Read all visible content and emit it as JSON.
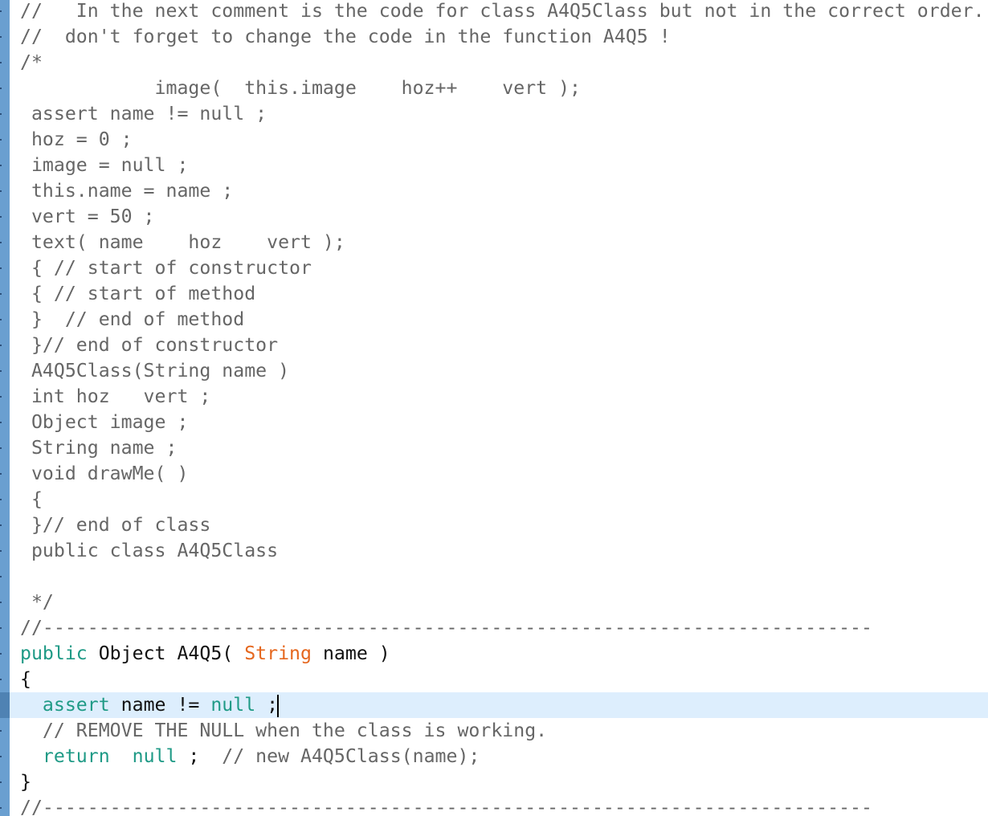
{
  "editor": {
    "gutter_color": "#6a9fd0",
    "current_line_highlight": "#ddeefd",
    "current_line_index": 27,
    "colors": {
      "comment": "#666666",
      "keyword": "#1f9a86",
      "type": "#e5671e",
      "plain": "#111111"
    },
    "lines": [
      [
        {
          "t": "//   In the next comment is the code for class A4Q5Class but not in the correct order.",
          "c": "cm"
        }
      ],
      [
        {
          "t": "//  don't forget to change the code in the function A4Q5 !",
          "c": "cm"
        }
      ],
      [
        {
          "t": "/*",
          "c": "cm"
        }
      ],
      [
        {
          "t": "            image(  this.image    hoz++    vert );",
          "c": "cm"
        }
      ],
      [
        {
          "t": " assert name != null ;",
          "c": "cm"
        }
      ],
      [
        {
          "t": " hoz = 0 ;",
          "c": "cm"
        }
      ],
      [
        {
          "t": " image = null ;",
          "c": "cm"
        }
      ],
      [
        {
          "t": " this.name = name ;",
          "c": "cm"
        }
      ],
      [
        {
          "t": " vert = 50 ;",
          "c": "cm"
        }
      ],
      [
        {
          "t": " text( name    hoz    vert );",
          "c": "cm"
        }
      ],
      [
        {
          "t": " { // start of constructor",
          "c": "cm"
        }
      ],
      [
        {
          "t": " { // start of method",
          "c": "cm"
        }
      ],
      [
        {
          "t": " }  // end of method",
          "c": "cm"
        }
      ],
      [
        {
          "t": " }// end of constructor",
          "c": "cm"
        }
      ],
      [
        {
          "t": " A4Q5Class(String name )",
          "c": "cm"
        }
      ],
      [
        {
          "t": " int hoz   vert ;",
          "c": "cm"
        }
      ],
      [
        {
          "t": " Object image ;",
          "c": "cm"
        }
      ],
      [
        {
          "t": " String name ;",
          "c": "cm"
        }
      ],
      [
        {
          "t": " void drawMe( )",
          "c": "cm"
        }
      ],
      [
        {
          "t": " {",
          "c": "cm"
        }
      ],
      [
        {
          "t": " }// end of class",
          "c": "cm"
        }
      ],
      [
        {
          "t": " public class A4Q5Class",
          "c": "cm"
        }
      ],
      [],
      [
        {
          "t": " */",
          "c": "cm"
        }
      ],
      [
        {
          "t": "//--------------------------------------------------------------------------",
          "c": "cm"
        }
      ],
      [
        {
          "t": "public",
          "c": "kw"
        },
        {
          "t": " Object A4Q5( ",
          "c": "pl"
        },
        {
          "t": "String",
          "c": "ty"
        },
        {
          "t": " name )",
          "c": "pl"
        }
      ],
      [
        {
          "t": "{",
          "c": "pl"
        }
      ],
      [
        {
          "t": "  ",
          "c": "pl"
        },
        {
          "t": "assert",
          "c": "kw"
        },
        {
          "t": " name != ",
          "c": "pl"
        },
        {
          "t": "null",
          "c": "kw"
        },
        {
          "t": " ;",
          "c": "pl"
        }
      ],
      [
        {
          "t": "  // REMOVE THE NULL when the class is working.",
          "c": "cm"
        }
      ],
      [
        {
          "t": "  ",
          "c": "pl"
        },
        {
          "t": "return",
          "c": "kw"
        },
        {
          "t": "  ",
          "c": "pl"
        },
        {
          "t": "null",
          "c": "kw"
        },
        {
          "t": " ;  ",
          "c": "pl"
        },
        {
          "t": "// new A4Q5Class(name);",
          "c": "cm"
        }
      ],
      [
        {
          "t": "}",
          "c": "pl"
        }
      ],
      [
        {
          "t": "//--------------------------------------------------------------------------",
          "c": "cm"
        }
      ]
    ]
  }
}
